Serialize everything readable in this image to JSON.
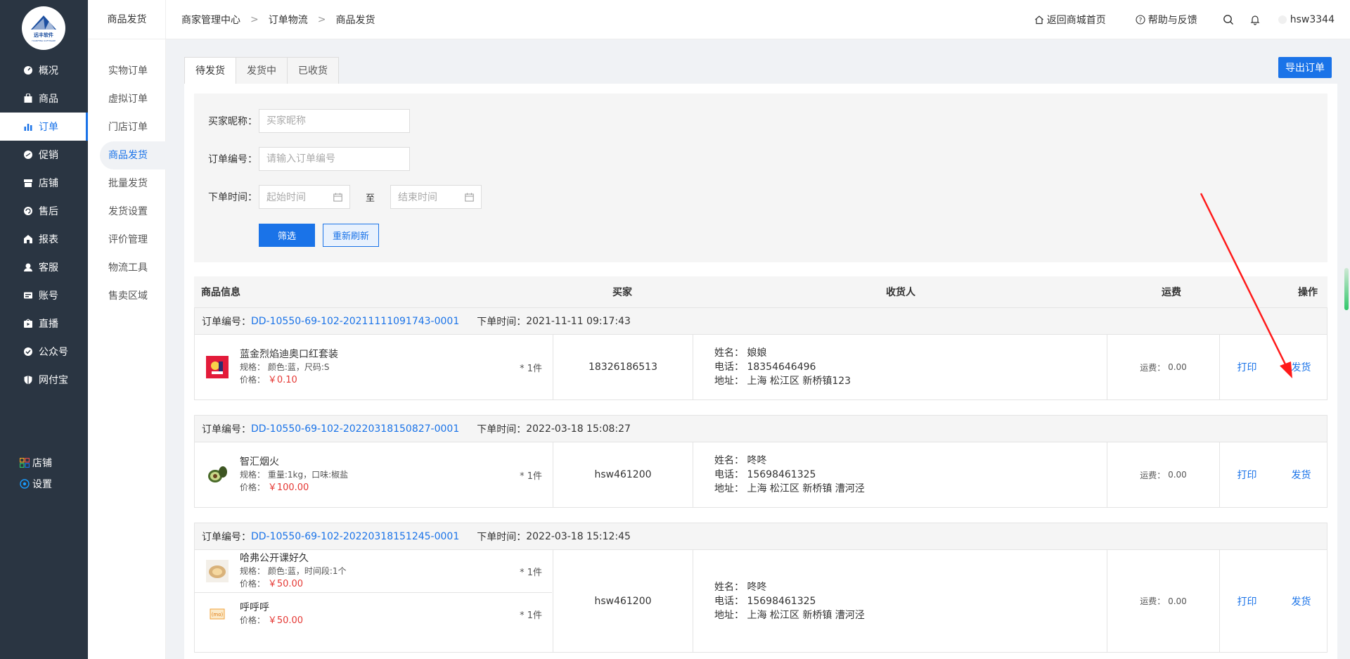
{
  "logo": {
    "text": "远丰软件"
  },
  "nav": {
    "items": [
      {
        "label": "概况",
        "icon": "dashboard-icon"
      },
      {
        "label": "商品",
        "icon": "bag-icon"
      },
      {
        "label": "订单",
        "icon": "bar-chart-icon"
      },
      {
        "label": "促销",
        "icon": "promo-icon"
      },
      {
        "label": "店铺",
        "icon": "store-icon"
      },
      {
        "label": "售后",
        "icon": "aftersale-icon"
      },
      {
        "label": "报表",
        "icon": "report-icon"
      },
      {
        "label": "客服",
        "icon": "service-icon"
      },
      {
        "label": "账号",
        "icon": "account-icon"
      },
      {
        "label": "直播",
        "icon": "live-icon"
      },
      {
        "label": "公众号",
        "icon": "shield-check-icon"
      },
      {
        "label": "网付宝",
        "icon": "shield-icon"
      }
    ],
    "active_index": 2,
    "bottom": [
      {
        "label": "店铺",
        "icon": "grid-icon"
      },
      {
        "label": "设置",
        "icon": "settings-icon"
      }
    ]
  },
  "subnav": {
    "title": "商品发货",
    "items": [
      "实物订单",
      "虚拟订单",
      "门店订单",
      "商品发货",
      "批量发货",
      "发货设置",
      "评价管理",
      "物流工具",
      "售卖区域"
    ],
    "active_index": 3
  },
  "header": {
    "breadcrumb": [
      "商家管理中心",
      "订单物流",
      "商品发货"
    ],
    "home_link": "返回商城首页",
    "help_link": "帮助与反馈",
    "username": "hsw3344"
  },
  "tabs": [
    "待发货",
    "发货中",
    "已收货"
  ],
  "export_label": "导出订单",
  "filter": {
    "buyer_label": "买家昵称：",
    "buyer_placeholder": "买家昵称",
    "order_label": "订单编号：",
    "order_placeholder": "请输入订单编号",
    "time_label": "下单时间：",
    "start_placeholder": "起始时间",
    "to_label": "至",
    "end_placeholder": "结束时间",
    "filter_btn": "筛选",
    "reset_btn": "重新刷新"
  },
  "columns": [
    "商品信息",
    "买家",
    "收货人",
    "运费",
    "操作"
  ],
  "labels": {
    "order_no": "订单编号：",
    "order_time": "下单时间：",
    "spec": "规格：",
    "price": "价格：",
    "name": "姓名：",
    "phone": "电话：",
    "address": "地址：",
    "fee": "运费：",
    "print": "打印",
    "ship": "发货"
  },
  "orders": [
    {
      "no": "DD-10550-69-102-20211111091743-0001",
      "time": "2021-11-11 09:17:43",
      "buyer": "18326186513",
      "recv_name": "娘娘",
      "recv_phone": "18354646496",
      "recv_addr": "上海 松江区 新桥镇123",
      "fee": "0.00",
      "products": [
        {
          "name": "蓝金烈焰迪奥口红套装",
          "spec": "颜色:蓝，尺码:S",
          "price": "￥0.10",
          "qty": "* 1件"
        }
      ]
    },
    {
      "no": "DD-10550-69-102-20220318150827-0001",
      "time": "2022-03-18 15:08:27",
      "buyer": "hsw461200",
      "recv_name": "咚咚",
      "recv_phone": "15698461325",
      "recv_addr": "上海 松江区 新桥镇 漕河泾",
      "fee": "0.00",
      "products": [
        {
          "name": "智汇烟火",
          "spec": "重量:1kg，口味:椒盐",
          "price": "￥100.00",
          "qty": "* 1件"
        }
      ]
    },
    {
      "no": "DD-10550-69-102-20220318151245-0001",
      "time": "2022-03-18 15:12:45",
      "buyer": "hsw461200",
      "recv_name": "咚咚",
      "recv_phone": "15698461325",
      "recv_addr": "上海 松江区 新桥镇 漕河泾",
      "fee": "0.00",
      "products": [
        {
          "name": "哈弗公开课好久",
          "spec": "颜色:蓝，时间段:1个",
          "price": "￥50.00",
          "qty": "* 1件"
        },
        {
          "name": "呼呼呼",
          "spec": "",
          "price": "￥50.00",
          "qty": "* 1件"
        }
      ]
    }
  ]
}
